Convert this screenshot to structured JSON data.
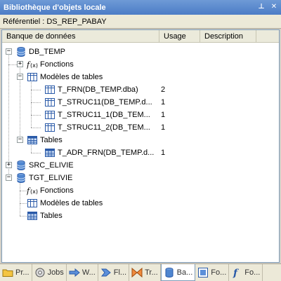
{
  "window": {
    "title": "Bibliothèque d'objets locale",
    "pin_glyph": "⊥",
    "close_glyph": "✕"
  },
  "referential": {
    "text": "Référentiel : DS_REP_PABAY"
  },
  "columns": {
    "name": "Banque de données",
    "usage": "Usage",
    "description": "Description"
  },
  "tree": {
    "db_temp": {
      "label": "DB_TEMP",
      "expander": "−"
    },
    "db_temp_functions": {
      "label": "Fonctions",
      "expander": "+"
    },
    "db_temp_templates": {
      "label": "Modèles de tables",
      "expander": "−"
    },
    "tpl1": {
      "label": "T_FRN(DB_TEMP.dba)",
      "usage": "2"
    },
    "tpl2": {
      "label": "T_STRUC11(DB_TEMP.d...",
      "usage": "1"
    },
    "tpl3": {
      "label": "T_STRUC11_1(DB_TEM...",
      "usage": "1"
    },
    "tpl4": {
      "label": "T_STRUC11_2(DB_TEM...",
      "usage": "1"
    },
    "db_temp_tables": {
      "label": "Tables",
      "expander": "−"
    },
    "tbl1": {
      "label": "T_ADR_FRN(DB_TEMP.d...",
      "usage": "1"
    },
    "src_elivie": {
      "label": "SRC_ELIVIE",
      "expander": "+"
    },
    "tgt_elivie": {
      "label": "TGT_ELIVIE",
      "expander": "−"
    },
    "tgt_functions": {
      "label": "Fonctions"
    },
    "tgt_templates": {
      "label": "Modèles de tables"
    },
    "tgt_tables": {
      "label": "Tables"
    }
  },
  "tabs": [
    {
      "label": "Pr...",
      "icon": "project-icon"
    },
    {
      "label": "Jobs",
      "icon": "jobs-icon"
    },
    {
      "label": "W...",
      "icon": "workflow-icon"
    },
    {
      "label": "Fl...",
      "icon": "dataflow-icon"
    },
    {
      "label": "Tr...",
      "icon": "transform-icon"
    },
    {
      "label": "Ba...",
      "icon": "datastore-icon"
    },
    {
      "label": "Fo...",
      "icon": "formats-icon"
    },
    {
      "label": "Fo...",
      "icon": "function-icon"
    }
  ]
}
